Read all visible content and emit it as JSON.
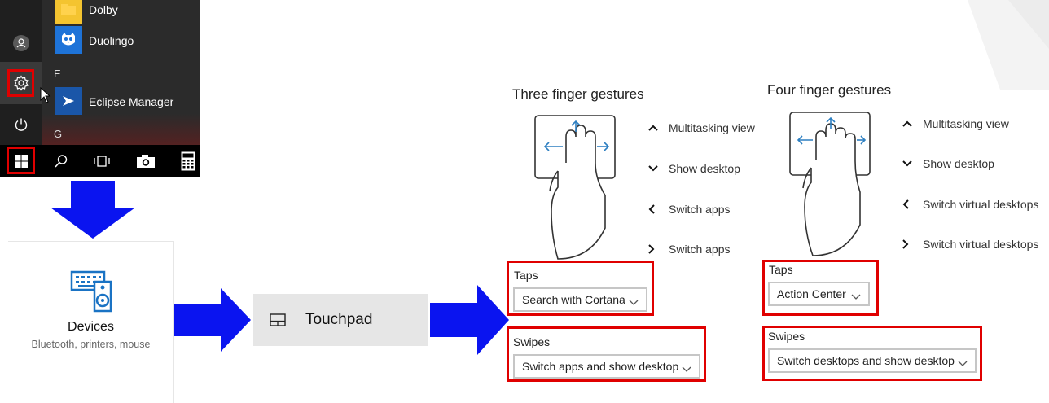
{
  "start_menu": {
    "apps": [
      {
        "label": "Dolby",
        "icon": "folder-icon",
        "color": "#f4c430"
      },
      {
        "label": "Duolingo",
        "icon": "duolingo-owl-icon",
        "color": "#1e73d8"
      },
      {
        "label": "Eclipse Manager",
        "icon": "eclipse-manager-icon",
        "color": "#1a56a8"
      }
    ],
    "letters": [
      "E",
      "G"
    ],
    "rail_icons": [
      "user-icon",
      "settings-gear-icon",
      "power-icon"
    ],
    "taskbar_icons": [
      "windows-start-icon",
      "search-icon",
      "task-view-icon",
      "camera-icon",
      "calculator-icon"
    ]
  },
  "devices_tile": {
    "title": "Devices",
    "subtitle": "Bluetooth, printers, mouse",
    "icon": "devices-keyboard-speaker-icon"
  },
  "touchpad_item": {
    "label": "Touchpad",
    "icon": "touchpad-icon"
  },
  "three_finger": {
    "title": "Three finger gestures",
    "gestures": [
      {
        "dir": "up",
        "label": "Multitasking view"
      },
      {
        "dir": "down",
        "label": "Show desktop"
      },
      {
        "dir": "left",
        "label": "Switch apps"
      },
      {
        "dir": "right",
        "label": "Switch apps"
      }
    ],
    "taps": {
      "label": "Taps",
      "value": "Search with Cortana"
    },
    "swipes": {
      "label": "Swipes",
      "value": "Switch apps and show desktop"
    }
  },
  "four_finger": {
    "title": "Four finger gestures",
    "gestures": [
      {
        "dir": "up",
        "label": "Multitasking view"
      },
      {
        "dir": "down",
        "label": "Show desktop"
      },
      {
        "dir": "left",
        "label": "Switch virtual desktops"
      },
      {
        "dir": "right",
        "label": "Switch virtual desktops"
      }
    ],
    "taps": {
      "label": "Taps",
      "value": "Action Center"
    },
    "swipes": {
      "label": "Swipes",
      "value": "Switch desktops and show desktop"
    }
  },
  "colors": {
    "highlight_red": "#e00000",
    "arrow_blue": "#0a14f0",
    "windows_blue": "#0078d7",
    "gesture_arrow": "#2d7fc1"
  }
}
